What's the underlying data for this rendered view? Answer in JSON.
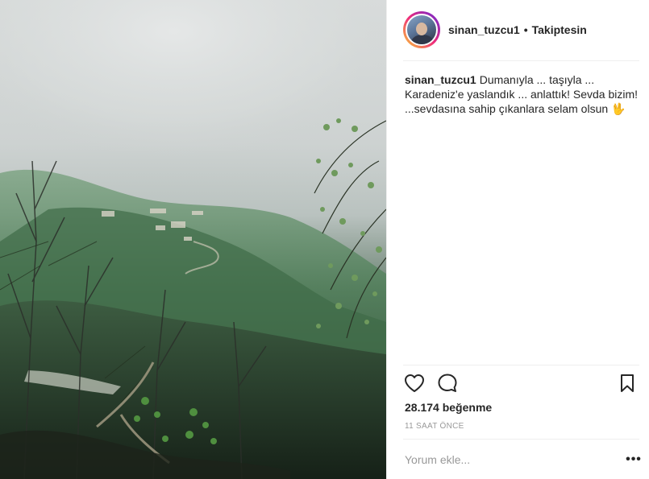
{
  "post": {
    "username": "sinan_tuzcu1",
    "separator": "•",
    "follow_status": "Takiptesin",
    "caption_user": "sinan_tuzcu1",
    "caption_lines": [
      "Dumanıyla ... taşıyla ...",
      "Karadeniz'e yaslandık ... anlattık! Sevda bizim!",
      "...sevdasına sahip çıkanlara selam olsun"
    ],
    "caption_emoji": "🖖",
    "likes": "28.174 beğenme",
    "time": "11 SAAT ÖNCE",
    "comment_placeholder": "Yorum ekle...",
    "more": "•••"
  },
  "icons": {
    "heart": "heart-icon",
    "comment": "comment-icon",
    "bookmark": "bookmark-icon",
    "more": "more-options-icon"
  },
  "colors": {
    "text": "#262626",
    "muted": "#999999",
    "border": "#efefef",
    "story_ring": [
      "#f9ce34",
      "#ee2a7b",
      "#6228d7"
    ]
  }
}
